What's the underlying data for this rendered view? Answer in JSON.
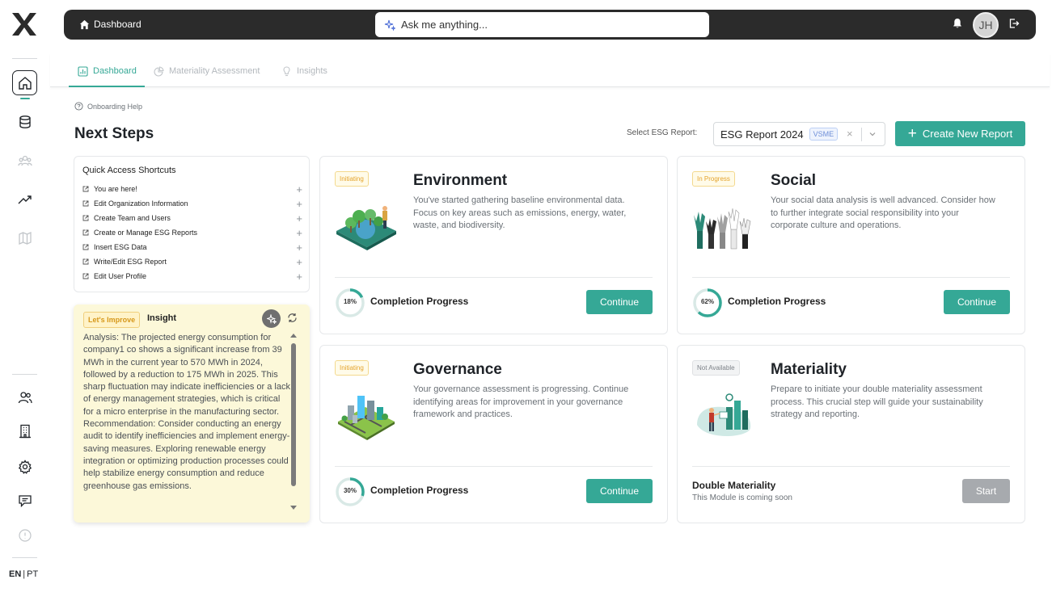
{
  "rail": {
    "language": {
      "en": "EN",
      "pt": "PT"
    }
  },
  "topbar": {
    "breadcrumb": "Dashboard",
    "ask_placeholder": "Ask me anything...",
    "avatar_initials": "JH"
  },
  "tabs": [
    {
      "label": "Dashboard",
      "active": true
    },
    {
      "label": "Materiality Assessment",
      "active": false
    },
    {
      "label": "Insights",
      "active": false
    }
  ],
  "help": "Onboarding Help",
  "page_title": "Next Steps",
  "report_select": {
    "label": "Select ESG Report:",
    "value": "ESG Report 2024",
    "tag": "VSME"
  },
  "create_button": "Create New Report",
  "quick_access": {
    "title": "Quick Access Shortcuts",
    "items": [
      "You are here!",
      "Edit Organization Information",
      "Create Team and Users",
      "Create or Manage ESG Reports",
      "Insert ESG Data",
      "Write/Edit ESG Report",
      "Edit User Profile"
    ]
  },
  "insight": {
    "badge": "Let's Improve",
    "title": "Insight",
    "text": "Analysis: The projected energy consumption for company1 co shows a significant increase from 39 MWh in the current year to 570 MWh in 2024, followed by a reduction to 175 MWh in 2025. This sharp fluctuation may indicate inefficiencies or a lack of energy management strategies, which is critical for a micro enterprise in the manufacturing sector.\nRecommendation: Consider conducting an energy audit to identify inefficiencies and implement energy-saving measures. Exploring renewable energy integration or optimizing production processes could help stabilize energy consumption and reduce greenhouse gas emissions."
  },
  "cards": {
    "environment": {
      "status": "Initiating",
      "title": "Environment",
      "description": "You've started gathering baseline environmental data. Focus on key areas such as emissions, energy, water, waste, and biodiversity.",
      "progress": 18,
      "progress_text": "18%",
      "progress_label": "Completion Progress",
      "button": "Continue"
    },
    "social": {
      "status": "In Progress",
      "title": "Social",
      "description": "Your social data analysis is well advanced. Consider how to further integrate social responsibility into your corporate culture and operations.",
      "progress": 62,
      "progress_text": "62%",
      "progress_label": "Completion Progress",
      "button": "Continue"
    },
    "governance": {
      "status": "Initiating",
      "title": "Governance",
      "description": "Your governance assessment is progressing. Continue identifying areas for improvement in your governance framework and practices.",
      "progress": 30,
      "progress_text": "30%",
      "progress_label": "Completion Progress",
      "button": "Continue"
    },
    "materiality": {
      "status": "Not Available",
      "title": "Materiality",
      "description": "Prepare to initiate your double materiality assessment process. This crucial step will guide your sustainability strategy and reporting.",
      "module_title": "Double Materiality",
      "module_sub": "This Module is coming soon",
      "button": "Start"
    }
  },
  "colors": {
    "accent": "#35a896",
    "topbar": "#2b2b2b",
    "insight_bg": "#fcf8d9",
    "status_amber": "#e4a32b"
  }
}
